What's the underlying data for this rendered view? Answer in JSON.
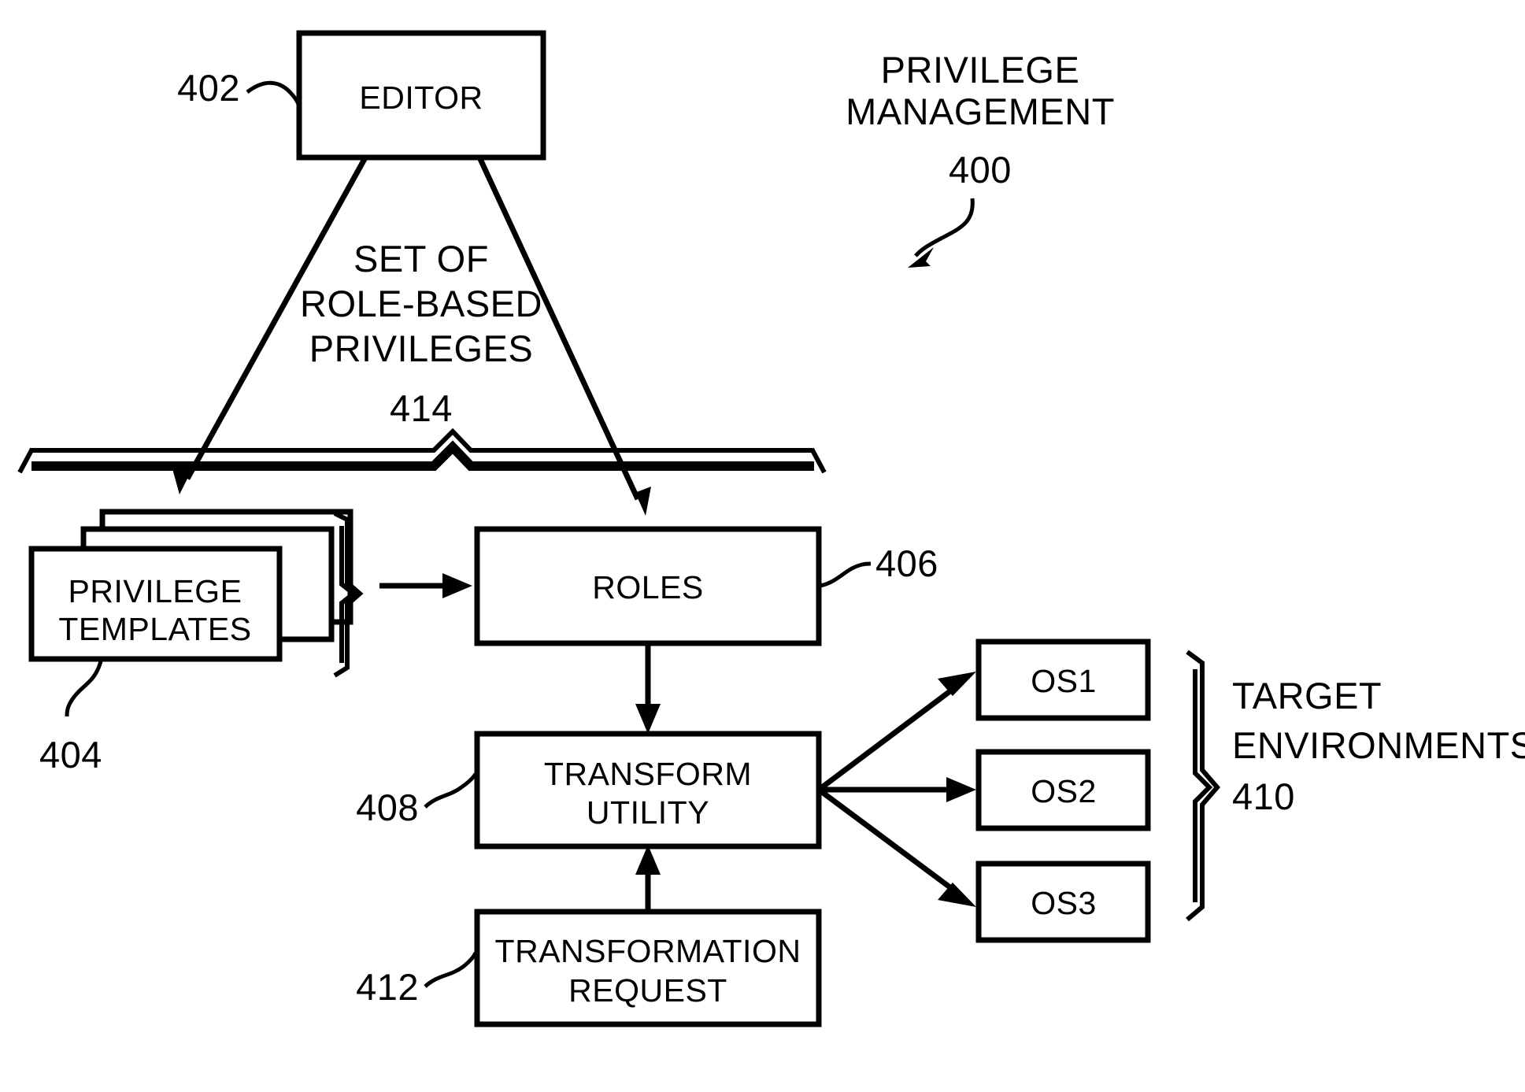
{
  "figure": {
    "title_block": {
      "line1": "PRIVILEGE",
      "line2": "MANAGEMENT",
      "ref": "400"
    },
    "nodes": [
      {
        "id": "editor",
        "label": "EDITOR",
        "ref": "402"
      },
      {
        "id": "privilege-templates",
        "label_line1": "PRIVILEGE",
        "label_line2": "TEMPLATES",
        "ref": "404",
        "stacked": true,
        "stack_count": 3
      },
      {
        "id": "roles",
        "label": "ROLES",
        "ref": "406"
      },
      {
        "id": "transform-utility",
        "label_line1": "TRANSFORM",
        "label_line2": "UTILITY",
        "ref": "408"
      },
      {
        "id": "transformation-request",
        "label_line1": "TRANSFORMATION",
        "label_line2": "REQUEST",
        "ref": "412"
      },
      {
        "id": "os1",
        "label": "OS1"
      },
      {
        "id": "os2",
        "label": "OS2"
      },
      {
        "id": "os3",
        "label": "OS3"
      }
    ],
    "annotations": [
      {
        "id": "set-of-role-based-privileges",
        "line1": "SET OF",
        "line2": "ROLE-BASED",
        "line3": "PRIVILEGES",
        "ref": "414"
      },
      {
        "id": "target-environments",
        "line1": "TARGET",
        "line2": "ENVIRONMENTS",
        "ref": "410"
      }
    ],
    "colors": {
      "ink": "#000000",
      "paper": "#ffffff"
    }
  }
}
